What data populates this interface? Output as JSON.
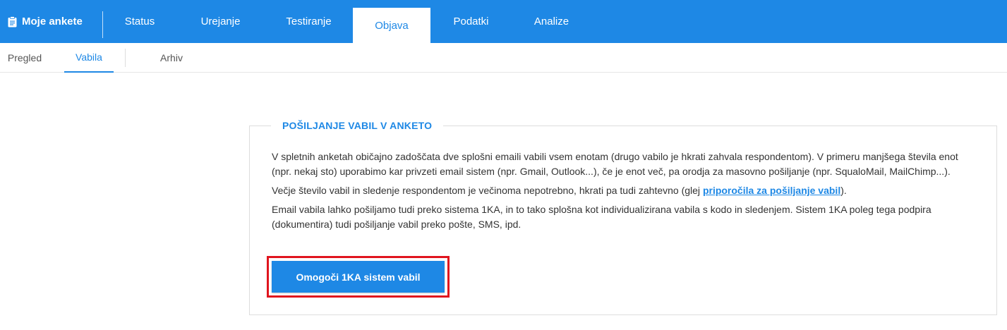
{
  "topnav": {
    "brand_label": "Moje ankete",
    "tabs": [
      {
        "label": "Status"
      },
      {
        "label": "Urejanje"
      },
      {
        "label": "Testiranje"
      },
      {
        "label": "Objava"
      },
      {
        "label": "Podatki"
      },
      {
        "label": "Analize"
      }
    ],
    "active_tab": "Objava"
  },
  "subnav": {
    "tabs": [
      {
        "label": "Pregled"
      },
      {
        "label": "Vabila"
      },
      {
        "label": "Arhiv"
      }
    ],
    "active_tab": "Vabila"
  },
  "panel": {
    "title": "POŠILJANJE VABIL V ANKETO",
    "paragraph1": "V spletnih anketah običajno zadoščata dve splošni emaili vabili vsem enotam (drugo vabilo je hkrati zahvala respondentom). V primeru manjšega števila enot (npr. nekaj sto) uporabimo kar privzeti email sistem (npr. Gmail, Outlook...), če je enot več, pa orodja za masovno pošiljanje (npr. SqualoMail, MailChimp...).",
    "paragraph2_before": "Večje število vabil in sledenje respondentom je večinoma nepotrebno, hkrati pa tudi zahtevno (glej ",
    "paragraph2_link": "priporočila za pošiljanje vabil",
    "paragraph2_after": ").",
    "paragraph3": "Email vabila lahko pošiljamo tudi preko sistema 1KA, in to tako splošna kot individualizirana vabila s kodo in sledenjem. Sistem 1KA poleg tega podpira (dokumentira) tudi pošiljanje vabil preko pošte, SMS, ipd.",
    "button_label": "Omogoči 1KA sistem vabil"
  },
  "colors": {
    "accent": "#1e88e5",
    "highlight": "#e0141e"
  }
}
